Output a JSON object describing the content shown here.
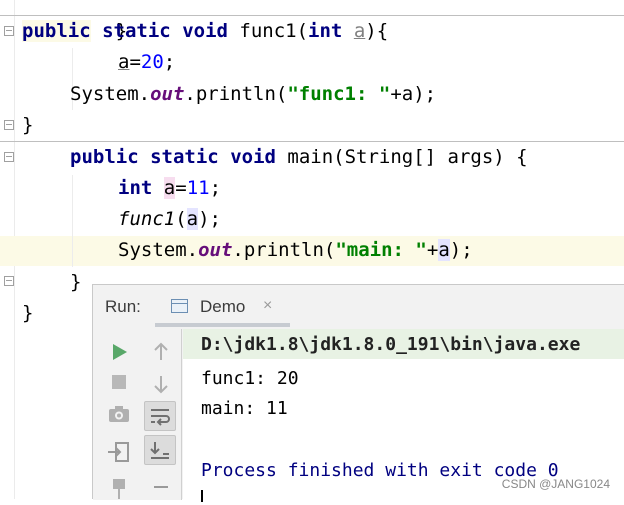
{
  "editor": {
    "top_brace": "}",
    "func1_signature": {
      "mod1": "public",
      "mod2": "static",
      "ret": "void",
      "name": "func1(",
      "ptype": "int",
      "param": "a",
      "tail": "){"
    },
    "func1_assign": {
      "var": "a",
      "eq": "=",
      "num": "20",
      "end": ";"
    },
    "func1_print": {
      "pre": "System.",
      "field": "out",
      "mid": ".println(",
      "str": "\"func1: \"",
      "plus": "+",
      "var": "a",
      "end": ");"
    },
    "func1_close": "}",
    "main_signature": {
      "mod1": "public",
      "mod2": "static",
      "ret": "void",
      "rest": "main(String[] args) {"
    },
    "main_decl": {
      "type": "int",
      "var": "a",
      "eq": "=",
      "num": "11",
      "end": ";"
    },
    "main_call": {
      "name": "func1",
      "open": "(",
      "var": "a",
      "end": ");"
    },
    "main_print": {
      "pre": "System.",
      "field": "out",
      "mid": ".println(",
      "str": "\"main: \"",
      "plus": "+",
      "var": "a",
      "end": ");"
    },
    "main_close": "}",
    "class_close": "}"
  },
  "run_panel": {
    "label": "Run:",
    "tab": {
      "label": "Demo",
      "close": "×",
      "icon": "console-window-icon"
    },
    "tools_left": [
      "run-icon",
      "stop-icon",
      "camera-icon",
      "login-icon",
      "pin-icon"
    ],
    "tools_right": [
      "up-arrow-icon",
      "down-arrow-icon",
      "soft-wrap-icon",
      "scroll-to-end-icon",
      "print-icon"
    ],
    "console": {
      "command": "D:\\jdk1.8\\jdk1.8.0_191\\bin\\java.exe",
      "lines": [
        "func1: 20",
        "main: 11"
      ],
      "exit": "Process finished with exit code 0"
    }
  },
  "watermark": "CSDN @JANG1024"
}
